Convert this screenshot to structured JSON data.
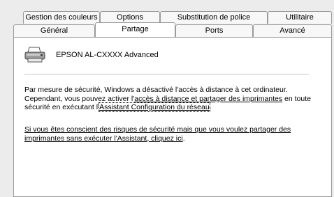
{
  "tabs_back": [
    "Gestion des couleurs",
    "Options",
    "Substitution de police",
    "Utilitaire"
  ],
  "tabs_front": [
    "Général",
    "Partage",
    "Ports",
    "Avancé"
  ],
  "active_tab": "Partage",
  "printer": {
    "name": "EPSON AL-CXXXX Advanced",
    "icon": "printer-icon"
  },
  "message": {
    "line1_before": "Par mesure de sécurité, Windows a désactivé l'accès à distance à cet ordinateur. Cependant, vous pouvez activer l'",
    "link1": "accès à distance et partager des imprimantes",
    "line1_after": " en toute sécurité en exécutant l'",
    "link2": "Assistant Configuration du réseau",
    "line1_end": ".",
    "link3": "Si vous êtes conscient des risques de sécurité mais que vous voulez partager des imprimantes sans exécuter l'Assistant, cliquez ici",
    "line2_end": "."
  }
}
